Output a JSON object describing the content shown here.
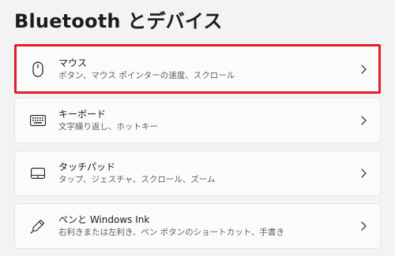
{
  "header": {
    "title": "Bluetooth とデバイス"
  },
  "settings": {
    "items": [
      {
        "title": "マウス",
        "subtitle": "ボタン、マウス ポインターの速度、スクロール",
        "icon": "mouse-icon"
      },
      {
        "title": "キーボード",
        "subtitle": "文字繰り返し、ホットキー",
        "icon": "keyboard-icon"
      },
      {
        "title": "タッチパッド",
        "subtitle": "タップ、ジェスチャ、スクロール、ズーム",
        "icon": "touchpad-icon"
      },
      {
        "title": "ペンと Windows Ink",
        "subtitle": "右利きまたは左利き、ペン ボタンのショートカット、手書き",
        "icon": "pen-icon"
      }
    ]
  },
  "colors": {
    "highlight_border": "#e0202c",
    "background": "#f3f3f3",
    "card": "#fbfbfb"
  }
}
